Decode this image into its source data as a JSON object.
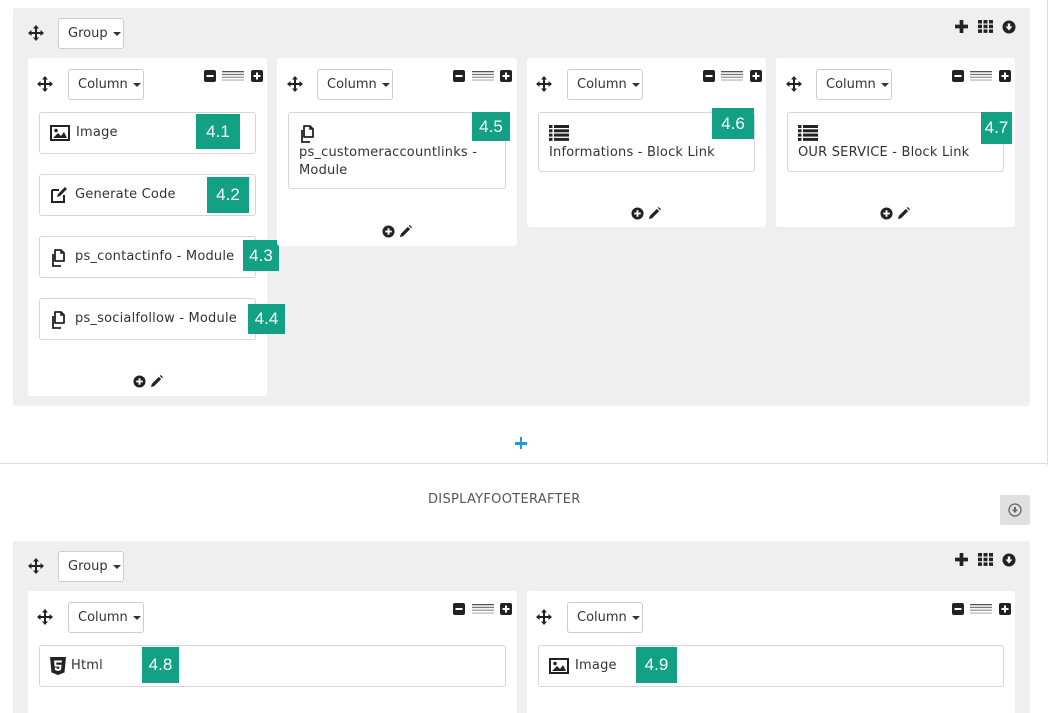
{
  "top_group": {
    "group_label": "Group",
    "columns": [
      {
        "label": "Column",
        "blocks": [
          {
            "icon": "image-icon",
            "text": "Image",
            "badge": "4.1"
          },
          {
            "icon": "edit-icon",
            "text": "Generate Code",
            "badge": "4.2"
          },
          {
            "icon": "module-icon",
            "text": "ps_contactinfo - Module",
            "badge": "4.3"
          },
          {
            "icon": "module-icon",
            "text": "ps_socialfollow - Module",
            "badge": "4.4"
          }
        ]
      },
      {
        "label": "Column",
        "blocks": [
          {
            "icon": "module-icon",
            "text_line1": "ps_customeraccountlinks -",
            "text_line2": "Module",
            "badge": "4.5"
          }
        ]
      },
      {
        "label": "Column",
        "blocks": [
          {
            "icon": "list-icon",
            "text": "Informations - Block Link",
            "badge": "4.6"
          }
        ]
      },
      {
        "label": "Column",
        "blocks": [
          {
            "icon": "list-icon",
            "text": "OUR SERVICE - Block Link",
            "badge": "4.7"
          }
        ]
      }
    ]
  },
  "hook_after": {
    "title": "DISPLAYFOOTERAFTER"
  },
  "bottom_group": {
    "group_label": "Group",
    "columns": [
      {
        "label": "Column",
        "blocks": [
          {
            "icon": "html5-icon",
            "text": "Html",
            "badge": "4.8"
          }
        ]
      },
      {
        "label": "Column",
        "blocks": [
          {
            "icon": "image-icon",
            "text": "Image",
            "badge": "4.9"
          }
        ]
      }
    ]
  },
  "colors": {
    "badge": "#12a184",
    "add_blue": "#1e9be0",
    "panel_bg": "#efefef"
  }
}
